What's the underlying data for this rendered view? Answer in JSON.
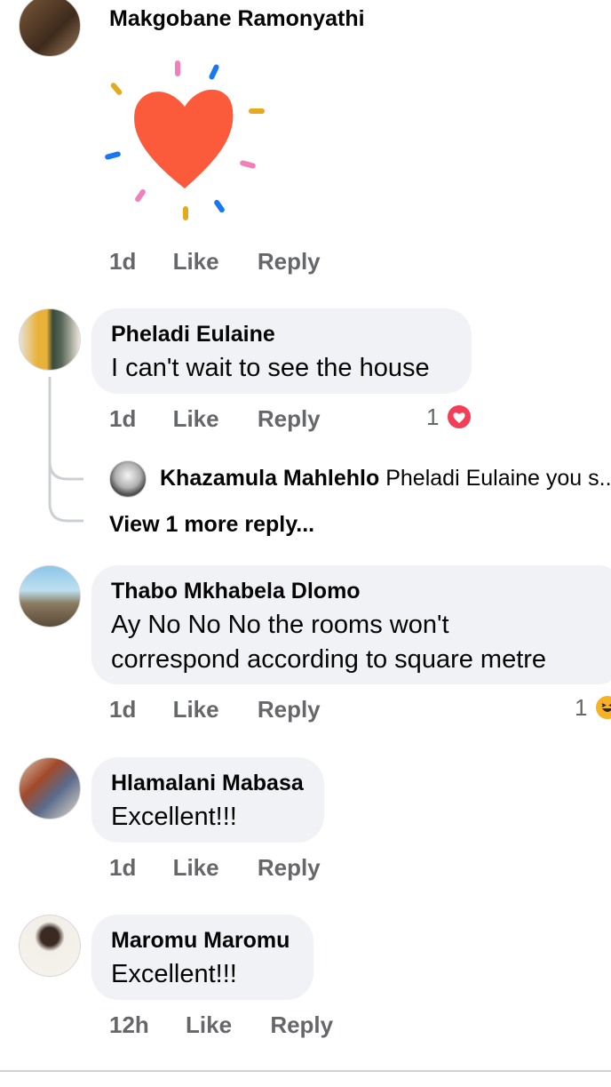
{
  "comments": [
    {
      "author": "Makgobane Ramonyathi",
      "time": "1d",
      "like": "Like",
      "reply": "Reply"
    },
    {
      "author": "Pheladi Eulaine",
      "text": "I can't wait to see the house",
      "time": "1d",
      "like": "Like",
      "reply": "Reply",
      "reaction_count": "1",
      "reaction_icon": "heart-icon",
      "replies": {
        "preview_author": "Khazamula Mahlehlo",
        "preview_text": "Pheladi Eulaine you s...",
        "more_link": "View 1 more reply..."
      }
    },
    {
      "author": "Thabo Mkhabela Dlomo",
      "text_line1": "Ay No No No the rooms won't",
      "text_line2": "correspond according to square metre",
      "time": "1d",
      "like": "Like",
      "reply": "Reply",
      "reaction_count": "1",
      "reaction_icon": "laugh-icon"
    },
    {
      "author": "Hlamalani Mabasa",
      "text": "Excellent!!!",
      "time": "1d",
      "like": "Like",
      "reply": "Reply"
    },
    {
      "author": "Maromu Maromu",
      "text": "Excellent!!!",
      "time": "12h",
      "like": "Like",
      "reply": "Reply"
    }
  ],
  "colors": {
    "bubble": "#f0f2f5",
    "meta_text": "#65676b",
    "heart_sticker": "#fb5b3a",
    "love_reaction": "#f33e58",
    "haha_reaction": "#f7b125"
  }
}
